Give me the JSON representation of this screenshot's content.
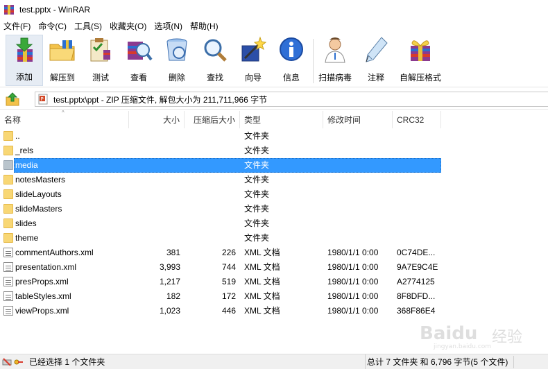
{
  "window": {
    "title": "test.pptx - WinRAR"
  },
  "menu": [
    "文件(F)",
    "命令(C)",
    "工具(S)",
    "收藏夹(O)",
    "选项(N)",
    "帮助(H)"
  ],
  "toolbar": {
    "add": "添加",
    "extract_to": "解压到",
    "test": "测试",
    "view": "查看",
    "delete": "删除",
    "find": "查找",
    "wizard": "向导",
    "info": "信息",
    "scan": "扫描病毒",
    "comment": "注释",
    "sfx": "自解压格式"
  },
  "path": {
    "text": "test.pptx\\ppt - ZIP 压缩文件, 解包大小为 211,711,966 字节"
  },
  "columns": {
    "name": "名称",
    "size": "大小",
    "packed": "压缩后大小",
    "type": "类型",
    "modified": "修改时间",
    "crc": "CRC32"
  },
  "files": [
    {
      "name": "..",
      "size": "",
      "packed": "",
      "type": "文件夹",
      "modified": "",
      "crc": ""
    },
    {
      "name": "_rels",
      "size": "",
      "packed": "",
      "type": "文件夹",
      "modified": "",
      "crc": ""
    },
    {
      "name": "media",
      "size": "",
      "packed": "",
      "type": "文件夹",
      "modified": "",
      "crc": ""
    },
    {
      "name": "notesMasters",
      "size": "",
      "packed": "",
      "type": "文件夹",
      "modified": "",
      "crc": ""
    },
    {
      "name": "slideLayouts",
      "size": "",
      "packed": "",
      "type": "文件夹",
      "modified": "",
      "crc": ""
    },
    {
      "name": "slideMasters",
      "size": "",
      "packed": "",
      "type": "文件夹",
      "modified": "",
      "crc": ""
    },
    {
      "name": "slides",
      "size": "",
      "packed": "",
      "type": "文件夹",
      "modified": "",
      "crc": ""
    },
    {
      "name": "theme",
      "size": "",
      "packed": "",
      "type": "文件夹",
      "modified": "",
      "crc": ""
    },
    {
      "name": "commentAuthors.xml",
      "size": "381",
      "packed": "226",
      "type": "XML 文档",
      "modified": "1980/1/1 0:00",
      "crc": "0C74DE..."
    },
    {
      "name": "presentation.xml",
      "size": "3,993",
      "packed": "744",
      "type": "XML 文档",
      "modified": "1980/1/1 0:00",
      "crc": "9A7E9C4E"
    },
    {
      "name": "presProps.xml",
      "size": "1,217",
      "packed": "519",
      "type": "XML 文档",
      "modified": "1980/1/1 0:00",
      "crc": "A2774125"
    },
    {
      "name": "tableStyles.xml",
      "size": "182",
      "packed": "172",
      "type": "XML 文档",
      "modified": "1980/1/1 0:00",
      "crc": "8F8DFD..."
    },
    {
      "name": "viewProps.xml",
      "size": "1,023",
      "packed": "446",
      "type": "XML 文档",
      "modified": "1980/1/1 0:00",
      "crc": "368F86E4"
    }
  ],
  "status": {
    "left": "已经选择 1 个文件夹",
    "right": "总计 7 文件夹 和 6,796 字节(5 个文件)"
  },
  "watermark": {
    "brand": "Baidu",
    "cn": "经验",
    "sub": "jingyan.baidu.com"
  },
  "colors": {
    "selection": "#3399ff",
    "folder": "#f8d775",
    "accent_blue": "#2a6fc9"
  }
}
